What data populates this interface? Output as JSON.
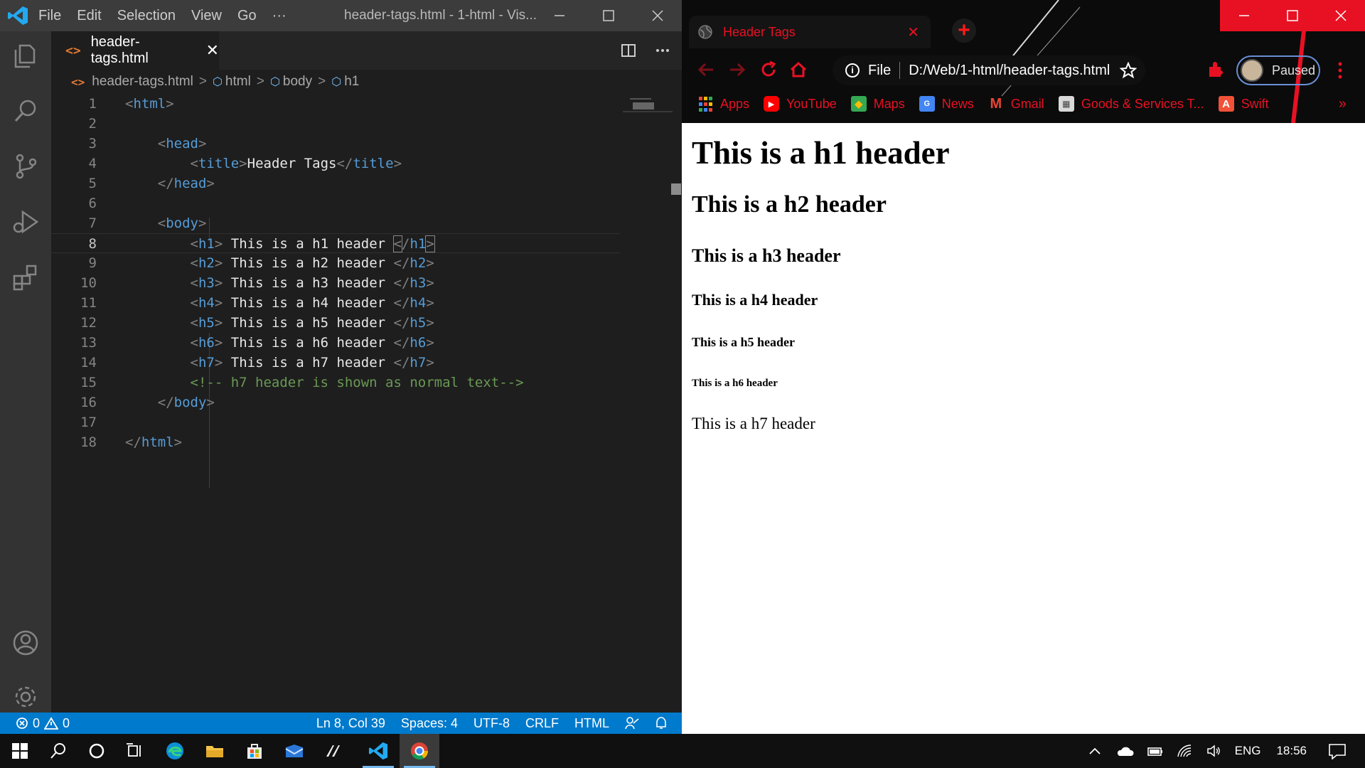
{
  "vscode": {
    "menu": [
      "File",
      "Edit",
      "Selection",
      "View",
      "Go",
      "···"
    ],
    "window_title": "header-tags.html - 1-html - Vis...",
    "tab": {
      "label": "header-tags.html",
      "close": "✕"
    },
    "breadcrumb": [
      "header-tags.html",
      "html",
      "body",
      "h1"
    ],
    "lines": [
      {
        "num": "1"
      },
      {
        "num": "2"
      },
      {
        "num": "3"
      },
      {
        "num": "4"
      },
      {
        "num": "5"
      },
      {
        "num": "6"
      },
      {
        "num": "7"
      },
      {
        "num": "8"
      },
      {
        "num": "9"
      },
      {
        "num": "10"
      },
      {
        "num": "11"
      },
      {
        "num": "12"
      },
      {
        "num": "13"
      },
      {
        "num": "14"
      },
      {
        "num": "15"
      },
      {
        "num": "16"
      },
      {
        "num": "17"
      },
      {
        "num": "18"
      }
    ],
    "code": {
      "title_text": "Header Tags",
      "h1_text": " This is a h1 header ",
      "h2_text": " This is a h2 header ",
      "h3_text": " This is a h3 header ",
      "h4_text": " This is a h4 header ",
      "h5_text": " This is a h5 header ",
      "h6_text": " This is a h6 header ",
      "h7_text": " This is a h7 header ",
      "comment": "<!-- h7 header is shown as normal text-->"
    },
    "status": {
      "errors": "0",
      "warnings": "0",
      "position": "Ln 8, Col 39",
      "spaces": "Spaces: 4",
      "encoding": "UTF-8",
      "eol": "CRLF",
      "language": "HTML"
    },
    "colors": {
      "statusbar": "#007acc",
      "activity": "#333333",
      "editor": "#1e1e1e"
    }
  },
  "chrome": {
    "tab_title": "Header Tags",
    "tab_close": "✕",
    "new_tab": "+",
    "omnibox_scheme": "File",
    "url": "D:/Web/1-html/header-tags.html",
    "profile_label": "Paused",
    "bookmarks": [
      {
        "label": "Apps",
        "icon": "apps-grid-icon"
      },
      {
        "label": "YouTube",
        "icon": "youtube-icon"
      },
      {
        "label": "Maps",
        "icon": "maps-icon"
      },
      {
        "label": "News",
        "icon": "news-icon"
      },
      {
        "label": "Gmail",
        "icon": "gmail-icon"
      },
      {
        "label": "Goods & Services T...",
        "icon": "gst-icon"
      },
      {
        "label": "Swift",
        "icon": "swift-icon"
      }
    ],
    "more_bookmarks": "»",
    "accent": "#e81123"
  },
  "page": {
    "h1": "This is a h1 header",
    "h2": "This is a h2 header",
    "h3": "This is a h3 header",
    "h4": "This is a h4 header",
    "h5": "This is a h5 header",
    "h6": "This is a h6 header",
    "h7": "This is a h7 header"
  },
  "taskbar": {
    "language": "ENG",
    "time": "18:56"
  }
}
